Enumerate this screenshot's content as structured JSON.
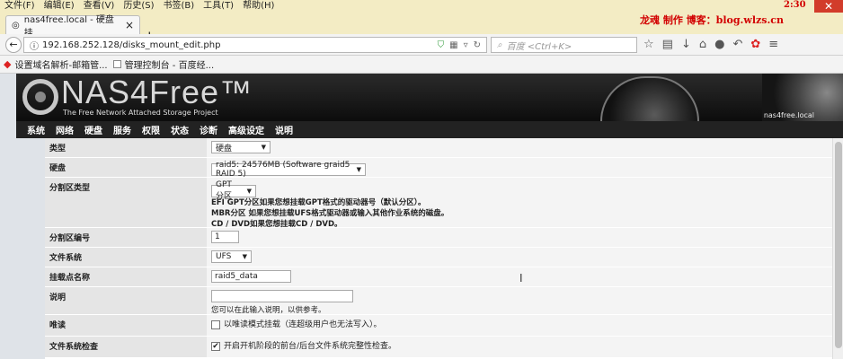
{
  "menubar": [
    "文件(F)",
    "编辑(E)",
    "查看(V)",
    "历史(S)",
    "书签(B)",
    "工具(T)",
    "帮助(H)"
  ],
  "watermark": "龙魂 制作 博客：blog.wlzs.cn",
  "watermark_time": "2:30",
  "tab": {
    "title": "nas4free.local - 硬盘挂..."
  },
  "address": {
    "url": "192.168.252.128/disks_mount_edit.php"
  },
  "search": {
    "placeholder": "百度 <Ctrl+K>"
  },
  "bookmarks": [
    "设置域名解析-邮箱管...",
    "管理控制台 - 百度经..."
  ],
  "header": {
    "logo": "NAS4Free™",
    "tagline": "The Free Network Attached Storage Project",
    "hostname": "nas4free.local"
  },
  "nav": [
    "系统",
    "网络",
    "硬盘",
    "服务",
    "权限",
    "状态",
    "诊断",
    "高级设定",
    "说明"
  ],
  "form": {
    "type": {
      "label": "类型",
      "value": "硬盘"
    },
    "disk": {
      "label": "硬盘",
      "value": "raid5: 24576MB (Software graid5 RAID 5)"
    },
    "parttype": {
      "label": "分割区类型",
      "value": "GPT 分区",
      "note1": "EFI GPT分区如果您想挂载GPT格式的驱动器号（默认分区）。",
      "note2": "MBR分区 如果您想挂载UFS格式驱动器或输入其他作业系统的磁盘。",
      "note3": "CD / DVD如果您想挂载CD / DVD。"
    },
    "partnum": {
      "label": "分割区编号",
      "value": "1"
    },
    "fs": {
      "label": "文件系统",
      "value": "UFS"
    },
    "mountname": {
      "label": "挂载点名称",
      "value": "raid5_data"
    },
    "desc": {
      "label": "说明",
      "value": "",
      "note": "您可以在此输入说明，以供参考。"
    },
    "readonly": {
      "label": "唯读",
      "text": "以唯读模式挂载（连超级用户也无法写入）。",
      "checked": false
    },
    "fscheck": {
      "label": "文件系统检查",
      "text": "开启开机阶段的前台/后台文件系统完整性检查。",
      "checked": true
    }
  }
}
